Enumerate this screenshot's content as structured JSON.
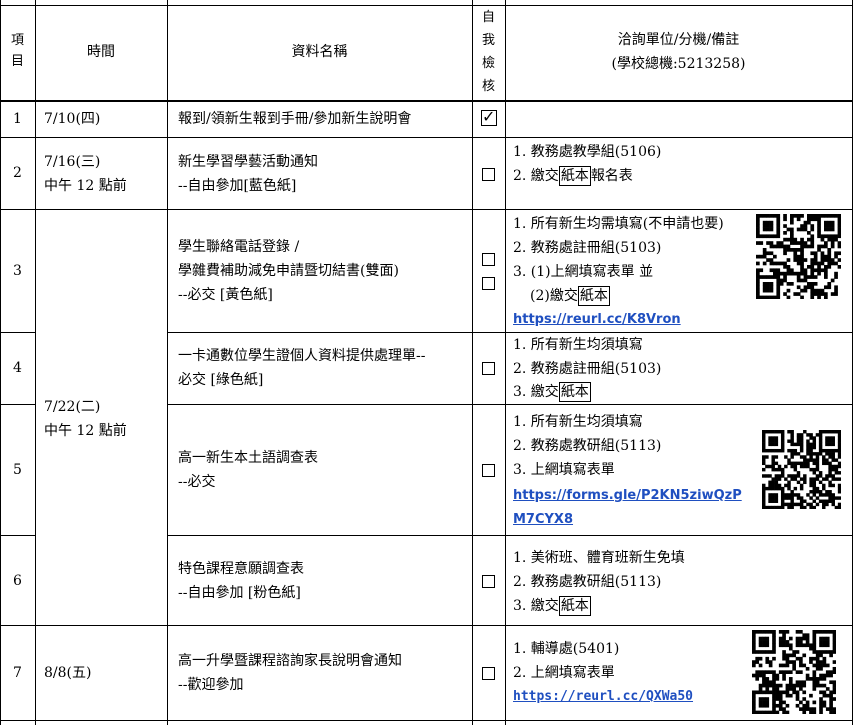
{
  "header": {
    "item": "項\n目",
    "time": "時間",
    "doc_name": "資料名稱",
    "self_check": "自\n我\n檢\n核",
    "contact": "洽詢單位/分機/備註",
    "school_phone": "(學校總機:5213258)"
  },
  "rows": [
    {
      "no": "1",
      "time": "7/10(四)",
      "name_lines": [
        "報到/領新生報到手冊/參加新生說明會"
      ],
      "checked": true
    },
    {
      "no": "2",
      "time": "7/16(三)\n中午 12 點前",
      "name_lines": [
        "新生學習學藝活動通知",
        "--自由參加[藍色紙]"
      ],
      "checked": false,
      "note_1": "1. 教務處教學組(5106)",
      "note_2_pre": "2. 繳交",
      "note_2_box": "紙本",
      "note_2_post": "報名表"
    },
    {
      "no": "3",
      "name_lines": [
        "學生聯絡電話登錄 /",
        "學雜費補助減免申請暨切結書(雙面)",
        "--必交 [黃色紙]"
      ],
      "checked": false,
      "note_1": "1. 所有新生均需填寫(不申請也要)",
      "note_2": "2. 教務處註冊組(5103)",
      "note_3": "3. (1)上網填寫表單     並",
      "note_4_pre": "(2)繳交",
      "note_4_box": "紙本",
      "link": "https://reurl.cc/K8Vron"
    },
    {
      "no": "4",
      "name_lines": [
        "一卡通數位學生證個人資料提供處理單--",
        "必交 [綠色紙]"
      ],
      "checked": false,
      "note_1": "1. 所有新生均須填寫",
      "note_2": "2. 教務處註冊組(5103)",
      "note_3_pre": "3. 繳交",
      "note_3_box": "紙本"
    },
    {
      "no": "5",
      "name_lines": [
        "高一新生本土語調查表",
        "--必交"
      ],
      "checked": false,
      "note_1": "1. 所有新生均須填寫",
      "note_2": "2. 教務處教研組(5113)",
      "note_3": "3. 上網填寫表單",
      "link_1": "https://forms.gle/P2KN5ziwQzP",
      "link_2": "M7CYX8"
    },
    {
      "no": "6",
      "name_lines": [
        "特色課程意願調查表",
        "--自由參加 [粉色紙]"
      ],
      "checked": false,
      "note_1": "1. 美術班、體育班新生免填",
      "note_2": "2. 教務處教研組(5113)",
      "note_3_pre": "3. 繳交",
      "note_3_box": "紙本"
    },
    {
      "no": "7",
      "time": "8/8(五)",
      "name_lines": [
        "高一升學暨課程諮詢家長說明會通知",
        "--歡迎參加"
      ],
      "checked": false,
      "note_1": "1. 輔導處(5401)",
      "note_2": "2. 上網填寫表單",
      "link": "https://reurl.cc/QXWa50"
    }
  ],
  "merged_time": "7/22(二)\n中午 12 點前",
  "check_mark": "✓",
  "icons": {
    "checkbox": "checkbox-icon",
    "qr": "qr-code-icon"
  }
}
